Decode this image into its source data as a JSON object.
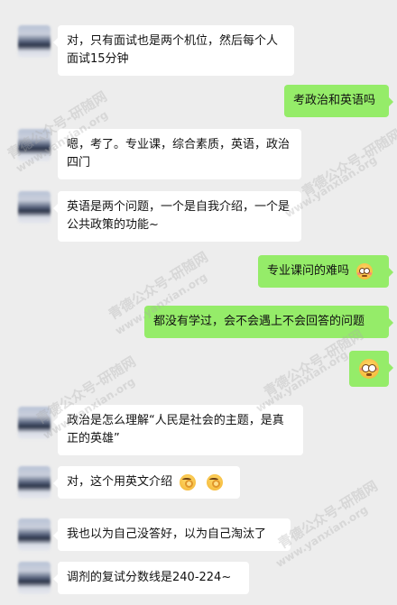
{
  "messages": [
    {
      "side": "left",
      "text": "对，只有面试也是两个机位，然后每个人面试15分钟"
    },
    {
      "side": "right",
      "text": "考政治和英语吗"
    },
    {
      "side": "left",
      "text": "嗯，考了。专业课，综合素质，英语，政治四门"
    },
    {
      "side": "left",
      "text": "英语是两个问题，一个是自我介绍，一个是公共政策的功能~"
    },
    {
      "side": "right",
      "text": "专业课问的难吗",
      "emoji": "flushed-face-icon"
    },
    {
      "side": "right",
      "text": "都没有学过，会不会遇上不会回答的问题"
    },
    {
      "side": "right",
      "text": "",
      "emoji": "flushed-face-icon"
    },
    {
      "side": "left",
      "text": "政治是怎么理解“人民是社会的主题，是真正的英雄”"
    },
    {
      "side": "left",
      "text": "对，这个用英文介绍",
      "emoji": "ok-hand-face-icon"
    },
    {
      "side": "left",
      "text": "我也以为自己没答好，以为自己淘汰了"
    },
    {
      "side": "left",
      "text": "调剂的复试分数线是240-224~"
    }
  ],
  "watermark": {
    "line1": "青德公众号-研随网",
    "line2": "www.yanxian.org"
  },
  "colors": {
    "background": "#ededed",
    "incoming": "#ffffff",
    "outgoing": "#95ec69"
  }
}
